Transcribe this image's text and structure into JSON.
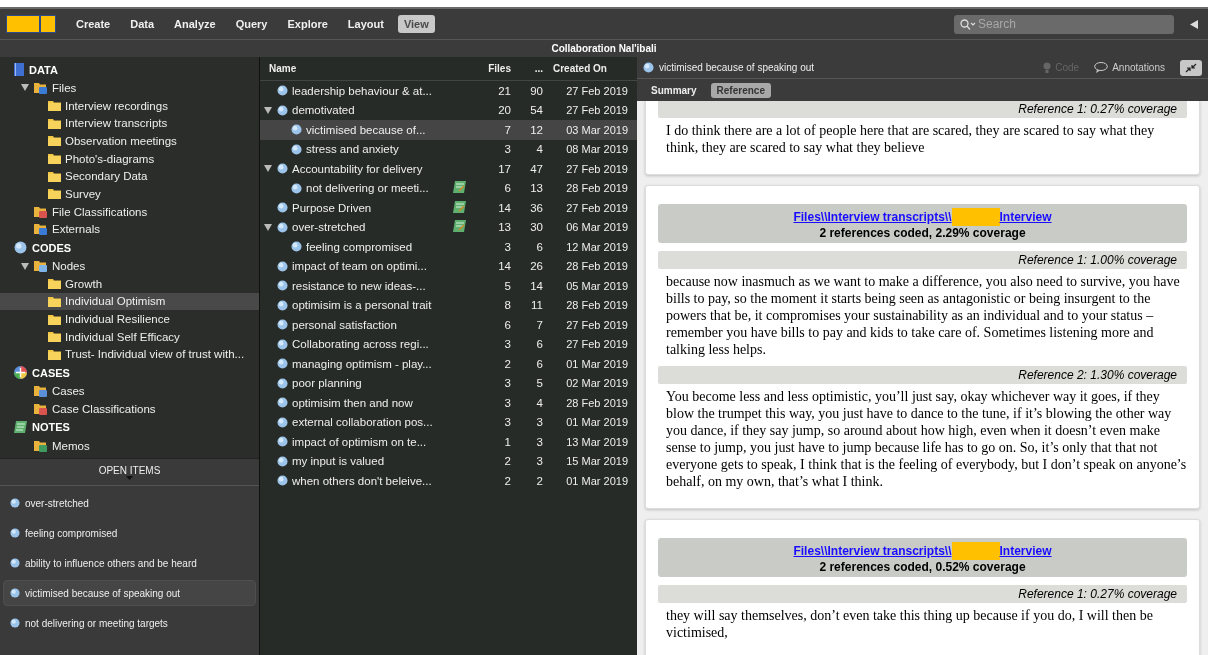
{
  "toolbar": {
    "tabs": [
      {
        "label": "Create",
        "selected": false
      },
      {
        "label": "Data",
        "selected": false
      },
      {
        "label": "Analyze",
        "selected": false
      },
      {
        "label": "Query",
        "selected": false
      },
      {
        "label": "Explore",
        "selected": false
      },
      {
        "label": "Layout",
        "selected": false
      },
      {
        "label": "View",
        "selected": true
      }
    ],
    "search": {
      "placeholder": "Search"
    }
  },
  "window": {
    "title": "Collaboration Nal'ibali"
  },
  "sidebar": {
    "sections": [
      {
        "title": "DATA",
        "kind": "data",
        "children": [
          {
            "label": "Files",
            "kind": "files",
            "selected": false,
            "expanded": true,
            "children": [
              {
                "label": "Interview recordings",
                "kind": "folder",
                "selected": false
              },
              {
                "label": "Interview transcripts",
                "kind": "folder",
                "selected": false
              },
              {
                "label": "Observation meetings",
                "kind": "folder",
                "selected": false
              },
              {
                "label": "Photo's-diagrams",
                "kind": "folder",
                "selected": false
              },
              {
                "label": "Secondary Data",
                "kind": "folder",
                "selected": false
              },
              {
                "label": "Survey",
                "kind": "folder",
                "selected": false
              }
            ]
          },
          {
            "label": "File Classifications",
            "kind": "classifications",
            "selected": false
          },
          {
            "label": "Externals",
            "kind": "externals",
            "selected": false
          }
        ]
      },
      {
        "title": "CODES",
        "kind": "codes",
        "children": [
          {
            "label": "Nodes",
            "kind": "nodes",
            "selected": false,
            "expanded": true,
            "children": [
              {
                "label": "Growth",
                "kind": "folder",
                "selected": false
              },
              {
                "label": "Individual Optimism",
                "kind": "folder",
                "selected": true
              },
              {
                "label": "Individual Resilience",
                "kind": "folder",
                "selected": false
              },
              {
                "label": "Individual Self Efficacy",
                "kind": "folder",
                "selected": false
              },
              {
                "label": "Trust- Individual view of trust with...",
                "kind": "folder",
                "selected": false
              }
            ]
          }
        ]
      },
      {
        "title": "CASES",
        "kind": "cases",
        "children": [
          {
            "label": "Cases",
            "kind": "cases",
            "selected": false
          },
          {
            "label": "Case Classifications",
            "kind": "classifications",
            "selected": false
          }
        ]
      },
      {
        "title": "NOTES",
        "kind": "notes",
        "children": [
          {
            "label": "Memos",
            "kind": "memos",
            "selected": false
          }
        ]
      }
    ],
    "open_items": {
      "title": "OPEN ITEMS",
      "items": [
        {
          "label": "over-stretched",
          "selected": false
        },
        {
          "label": "feeling compromised",
          "selected": false
        },
        {
          "label": "ability to influence others and be heard",
          "selected": false
        },
        {
          "label": "victimised because of speaking out",
          "selected": true
        },
        {
          "label": "not delivering or meeting targets",
          "selected": false
        }
      ]
    }
  },
  "table": {
    "columns": [
      "Name",
      "Files",
      "...",
      "Created On"
    ],
    "rows": [
      {
        "name": "leadership behaviour & at...",
        "memo": false,
        "files": "21",
        "refs": "90",
        "created": "27 Feb 2019",
        "selected": false
      },
      {
        "name": "demotivated",
        "memo": false,
        "files": "20",
        "refs": "54",
        "created": "27 Feb 2019",
        "selected": false,
        "expanded": true,
        "children": [
          {
            "name": "victimised because of...",
            "memo": false,
            "files": "7",
            "refs": "12",
            "created": "03 Mar 2019",
            "selected": true
          },
          {
            "name": "stress and anxiety",
            "memo": false,
            "files": "3",
            "refs": "4",
            "created": "08 Mar 2019",
            "selected": false
          }
        ]
      },
      {
        "name": "Accountability for delivery",
        "memo": false,
        "files": "17",
        "refs": "47",
        "created": "27 Feb 2019",
        "selected": false,
        "expanded": true,
        "children": [
          {
            "name": "not delivering or meeti...",
            "memo": true,
            "files": "6",
            "refs": "13",
            "created": "28 Feb 2019",
            "selected": false
          }
        ]
      },
      {
        "name": "Purpose Driven",
        "memo": true,
        "files": "14",
        "refs": "36",
        "created": "27 Feb 2019",
        "selected": false
      },
      {
        "name": "over-stretched",
        "memo": true,
        "files": "13",
        "refs": "30",
        "created": "06 Mar 2019",
        "selected": false,
        "expanded": true,
        "children": [
          {
            "name": "feeling compromised",
            "memo": false,
            "files": "3",
            "refs": "6",
            "created": "12 Mar 2019",
            "selected": false
          }
        ]
      },
      {
        "name": "impact of team on optimi...",
        "memo": false,
        "files": "14",
        "refs": "26",
        "created": "28 Feb 2019",
        "selected": false
      },
      {
        "name": "resistance to new ideas-...",
        "memo": false,
        "files": "5",
        "refs": "14",
        "created": "05 Mar 2019",
        "selected": false
      },
      {
        "name": "optimisim is a personal trait",
        "memo": false,
        "files": "8",
        "refs": "11",
        "created": "28 Feb 2019",
        "selected": false
      },
      {
        "name": "personal satisfaction",
        "memo": false,
        "files": "6",
        "refs": "7",
        "created": "27 Feb 2019",
        "selected": false
      },
      {
        "name": "Collaborating across regi...",
        "memo": false,
        "files": "3",
        "refs": "6",
        "created": "27 Feb 2019",
        "selected": false
      },
      {
        "name": "managing optimism - play...",
        "memo": false,
        "files": "2",
        "refs": "6",
        "created": "01 Mar 2019",
        "selected": false
      },
      {
        "name": "poor planning",
        "memo": false,
        "files": "3",
        "refs": "5",
        "created": "02 Mar 2019",
        "selected": false
      },
      {
        "name": "optimisim then and now",
        "memo": false,
        "files": "3",
        "refs": "4",
        "created": "28 Feb 2019",
        "selected": false
      },
      {
        "name": "external collaboration pos...",
        "memo": false,
        "files": "3",
        "refs": "3",
        "created": "01 Mar 2019",
        "selected": false
      },
      {
        "name": "impact of optimism on te...",
        "memo": false,
        "files": "1",
        "refs": "3",
        "created": "13 Mar 2019",
        "selected": false
      },
      {
        "name": "my input is valued",
        "memo": false,
        "files": "2",
        "refs": "3",
        "created": "15 Mar 2019",
        "selected": false
      },
      {
        "name": "when others don't beleive...",
        "memo": false,
        "files": "2",
        "refs": "2",
        "created": "01 Mar 2019",
        "selected": false
      }
    ]
  },
  "detail": {
    "title": "victimised because of speaking out",
    "code": {
      "label": "Code",
      "disabled": true
    },
    "annotations": {
      "label": "Annotations",
      "disabled": false
    },
    "tabs": [
      {
        "label": "Summary",
        "selected": false
      },
      {
        "label": "Reference",
        "selected": true
      }
    ],
    "cards": [
      {
        "references": [
          {
            "label": "Reference 1: 0.27% coverage",
            "text": "I do think there are a lot of people here that are scared, they are scared to say what they think, they are scared to say what they believe"
          }
        ]
      },
      {
        "link_start": "Files\\\\Interview transcripts\\\\",
        "link_end": "Interview",
        "summary": "2 references coded, 2.29% coverage",
        "references": [
          {
            "label": "Reference 1: 1.00% coverage",
            "text": "because now inasmuch as we want to make a difference, you also need to survive, you have bills to pay, so the moment it starts being seen as antagonistic or being insurgent to the powers that be, it compromises your sustainability as an individual and to your status – remember you have bills to pay and kids to take care of. Sometimes listening more and talking less helps."
          },
          {
            "label": "Reference 2: 1.30% coverage",
            "text": "You become less and less optimistic, you’ll just say, okay whichever way it goes, if they blow the trumpet this way, you just have to dance to the tune, if it’s blowing the other way you dance, if they say jump, so around about how high, even when it doesn’t even make sense to jump, you just have to jump because life has to go on. So, it’s only that that not everyone gets to speak, I think that is the feeling of everybody, but I don’t speak on anyone’s behalf, on my own, that’s what I think."
          }
        ]
      },
      {
        "link_start": "Files\\\\Interview transcripts\\\\",
        "link_end": "Interview",
        "summary": "2 references coded, 0.52% coverage",
        "references": [
          {
            "label": "Reference 1: 0.27% coverage",
            "text": "they will say themselves, don’t even take this thing up because if you do, I will then be victimised,"
          }
        ]
      }
    ]
  }
}
